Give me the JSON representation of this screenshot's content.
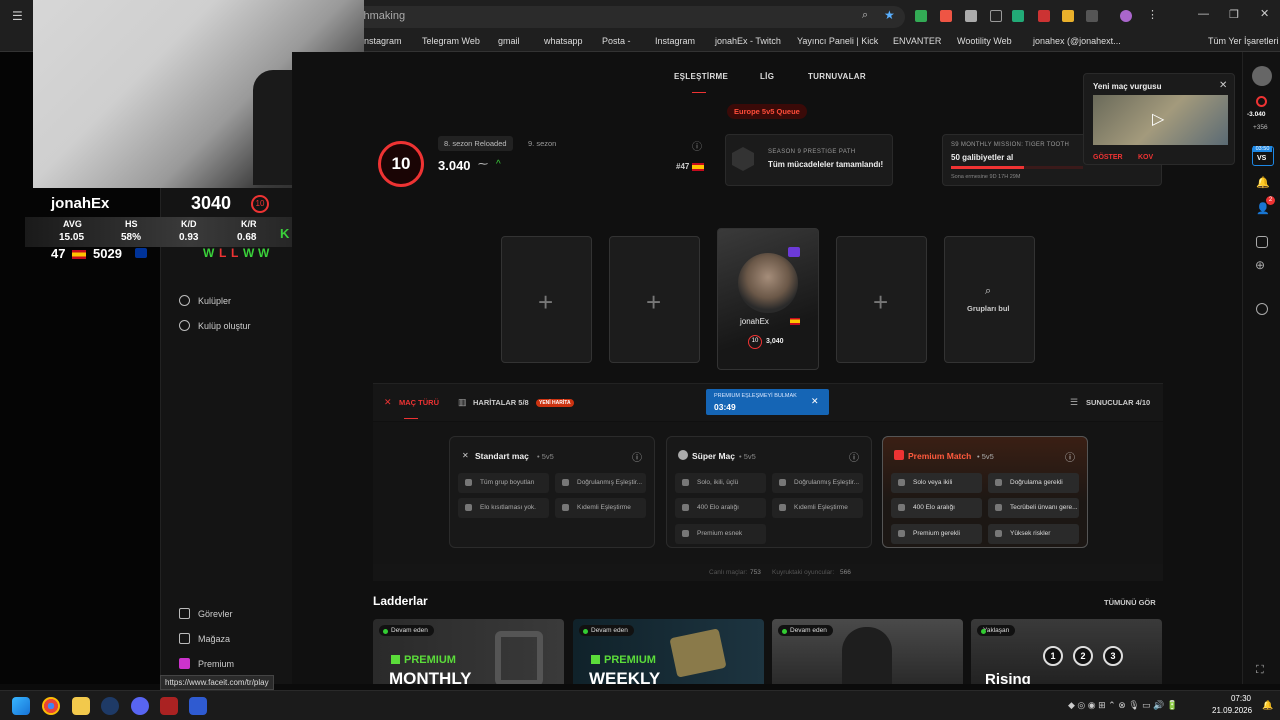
{
  "browser": {
    "address_text": "chmaking",
    "bookmarks": [
      "nstagram",
      "Telegram Web",
      "gmail",
      "whatsapp",
      "Posta -",
      "Instagram",
      "jonahEx - Twitch",
      "Yayıncı Paneli | Kick",
      "ENVANTER",
      "Wootility Web",
      "jonahex (@jonahext...",
      "Tüm Yer İşaretleri"
    ],
    "status_url": "https://www.faceit.com/tr/play"
  },
  "overlay": {
    "username": "jonahEx",
    "elo": "3040",
    "level": "10",
    "stat_labels": [
      "AVG",
      "HS",
      "K/D",
      "K/R"
    ],
    "stat_values": [
      "15.05",
      "58%",
      "0.93",
      "0.68"
    ],
    "rank": "47",
    "second_value": "5029",
    "kick_value": "35",
    "recent": [
      "W",
      "L",
      "L",
      "W",
      "W"
    ]
  },
  "sidebar": {
    "clubs": "Kulüpler",
    "create_club": "Kulüp oluştur",
    "missions": "Görevler",
    "shop": "Mağaza",
    "premium": "Premium"
  },
  "header": {
    "tabs": [
      "EŞLEŞTİRME",
      "LİG",
      "TURNUVALAR"
    ],
    "queue_badge": "Europe 5v5 Queue"
  },
  "profile": {
    "level": "10",
    "season_tags": [
      "8. sezon Reloaded",
      "9. sezon"
    ],
    "elo": "3.040",
    "rank": "#47",
    "prestige_label": "SEASON 9 PRESTIGE PATH",
    "prestige_text": "Tüm mücadeleler tamamlandı!",
    "mission_label": "S9 MONTHLY MISSION: TIGER TOOTH",
    "mission_title": "50 galibiyetler al",
    "mission_time": "Sona ermesine 9D 17H 29M",
    "mission_progress": 0.55
  },
  "party": {
    "player_name": "jonahEx",
    "player_level": "10",
    "player_elo": "3,040",
    "find_groups": "Grupları bul"
  },
  "match_bar": {
    "match_type": "MAÇ TÜRÜ",
    "maps": "HARİTALAR 5/8",
    "new_map_badge": "YENİ HARİTA",
    "searching_label": "PREMIUM EŞLEŞMEYİ BULMAK",
    "timer": "03:49",
    "servers": "SUNUCULAR 4/10"
  },
  "modes": [
    {
      "title": "Standart maç",
      "suffix": "• 5v5",
      "features": [
        "Tüm grup boyutları",
        "Doğrulanmış Eşleştir...",
        "Elo kısıtlaması yok.",
        "Kıdemli Eşleştirme"
      ]
    },
    {
      "title": "Süper Maç",
      "suffix": "• 5v5",
      "features": [
        "Solo, ikili, üçlü",
        "Doğrulanmış Eşleştir...",
        "400 Elo aralığı",
        "Kıdemli Eşleştirme",
        "Premium esnek"
      ]
    },
    {
      "title": "Premium Match",
      "suffix": "• 5v5",
      "features": [
        "Solo veya ikili",
        "Doğrulama gerekli",
        "400 Elo aralığı",
        "Tecrübeli ünvanı gere...",
        "Premium gerekli",
        "Yüksek riskler"
      ]
    }
  ],
  "counts": {
    "live_label": "Canlı maçlar:",
    "live_value": "753",
    "queue_label": "Kuyruktaki oyuncular:",
    "queue_value": "566"
  },
  "ladders": {
    "title": "Ladderlar",
    "see_all": "TÜMÜNÜ GÖR",
    "items": [
      {
        "status": "Devam eden",
        "brand": "PREMIUM",
        "name": "MONTHLY"
      },
      {
        "status": "Devam eden",
        "brand": "PREMIUM",
        "name": "WEEKLY"
      },
      {
        "status": "Devam eden",
        "brand": "",
        "name": ""
      },
      {
        "status": "Yaklaşan",
        "brand": "",
        "name": "Rising"
      }
    ]
  },
  "highlight": {
    "title": "Yeni maç vurgusu",
    "show": "GÖSTER",
    "dismiss": "KOV"
  },
  "rail": {
    "elo_delta": "-3.040",
    "plus": "+356",
    "timer": "03:50",
    "badge": "2"
  },
  "taskbar": {
    "time": "07:30",
    "date": "21.09.2026"
  },
  "colors": {
    "accent": "#ff5500",
    "danger": "#e23b2e",
    "win": "#3ad13a",
    "loss": "#e33"
  }
}
